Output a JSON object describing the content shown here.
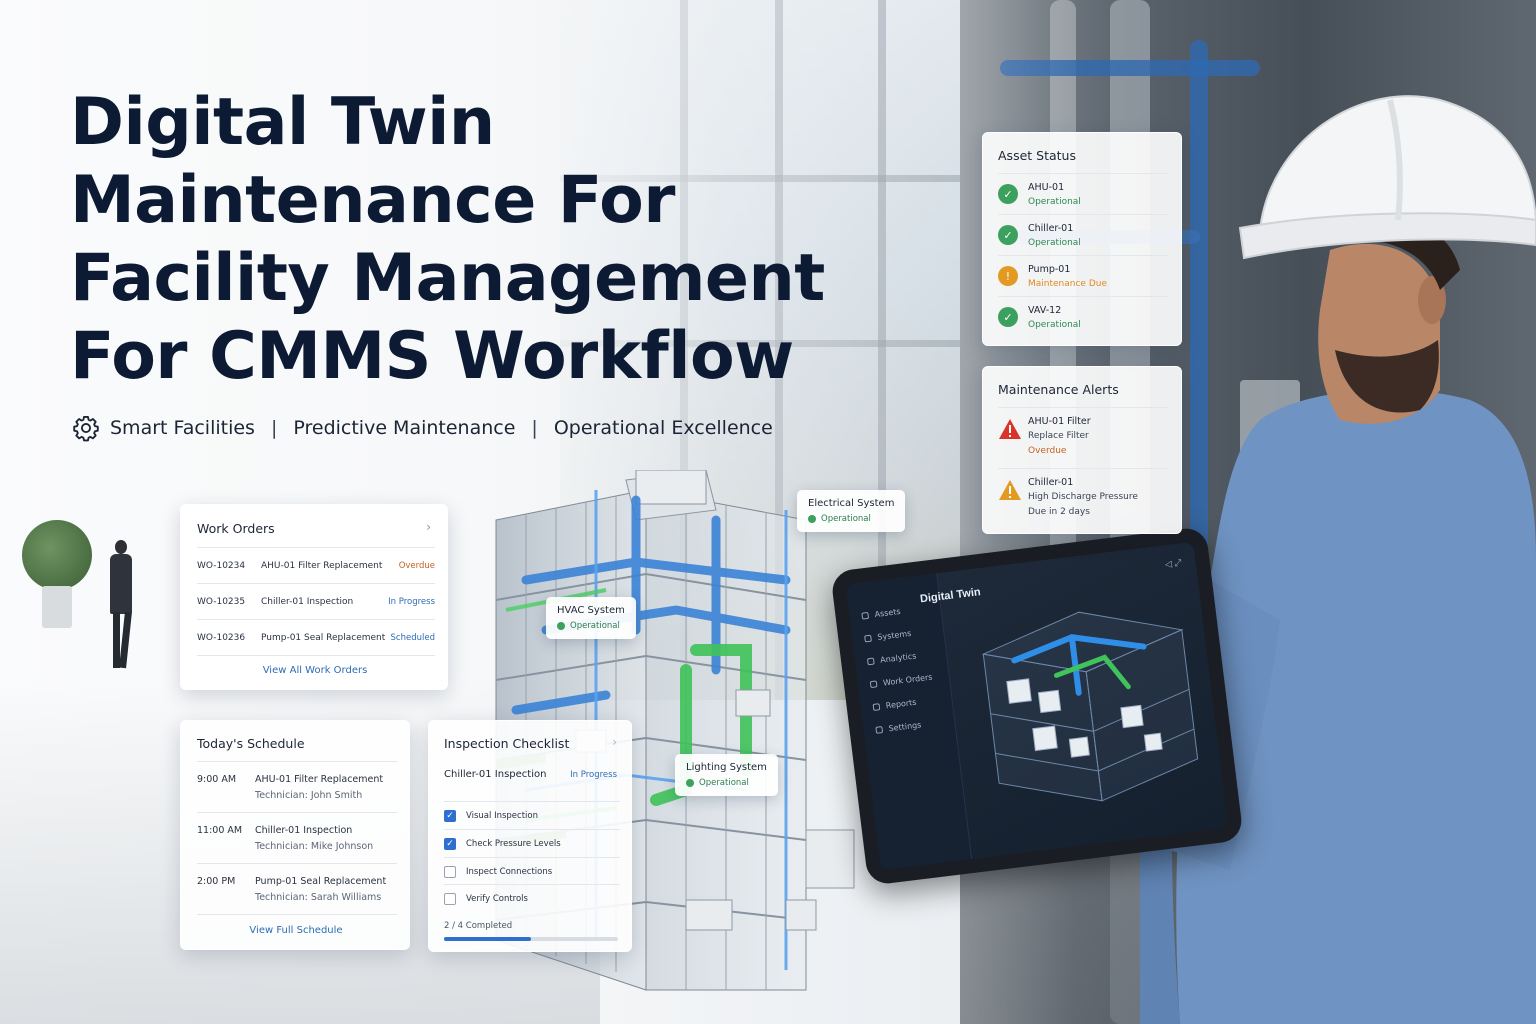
{
  "headline": {
    "line1": "Digital Twin",
    "line2": "Maintenance For",
    "line3": "Facility Management",
    "line4": "For CMMS Workflow"
  },
  "tagline": {
    "item1": "Smart Facilities",
    "sep": "|",
    "item2": "Predictive Maintenance",
    "item3": "Operational Excellence"
  },
  "work_orders": {
    "title": "Work Orders",
    "rows": [
      {
        "id": "WO-10234",
        "desc": "AHU-01 Filter Replacement",
        "status": "Overdue"
      },
      {
        "id": "WO-10235",
        "desc": "Chiller-01 Inspection",
        "status": "In Progress"
      },
      {
        "id": "WO-10236",
        "desc": "Pump-01 Seal Replacement",
        "status": "Scheduled"
      }
    ],
    "link": "View All Work Orders"
  },
  "schedule": {
    "title": "Today's Schedule",
    "rows": [
      {
        "time": "9:00 AM",
        "task": "AHU-01 Filter Replacement",
        "tech": "Technician: John Smith"
      },
      {
        "time": "11:00 AM",
        "task": "Chiller-01 Inspection",
        "tech": "Technician: Mike Johnson"
      },
      {
        "time": "2:00 PM",
        "task": "Pump-01 Seal Replacement",
        "tech": "Technician: Sarah Williams"
      }
    ],
    "link": "View Full Schedule"
  },
  "inspection": {
    "title": "Inspection Checklist",
    "subject": "Chiller-01 Inspection",
    "status": "In Progress",
    "items": [
      {
        "label": "Visual Inspection",
        "checked": true
      },
      {
        "label": "Check Pressure Levels",
        "checked": true
      },
      {
        "label": "Inspect Connections",
        "checked": false
      },
      {
        "label": "Verify Controls",
        "checked": false
      }
    ],
    "progress_label": "2 / 4 Completed",
    "progress": 0.5
  },
  "asset_status": {
    "title": "Asset Status",
    "rows": [
      {
        "name": "AHU-01",
        "status": "Operational"
      },
      {
        "name": "Chiller-01",
        "status": "Operational"
      },
      {
        "name": "Pump-01",
        "status": "Maintenance Due"
      },
      {
        "name": "VAV-12",
        "status": "Operational"
      }
    ]
  },
  "maintenance_alerts": {
    "title": "Maintenance Alerts",
    "rows": [
      {
        "l1": "AHU-01 Filter",
        "l2": "Replace Filter",
        "l3": "Overdue"
      },
      {
        "l1": "Chiller-01",
        "l2": "High Discharge Pressure",
        "l3": "Due in 2 days"
      }
    ]
  },
  "system_tags": {
    "electrical": {
      "name": "Electrical System",
      "status": "Operational"
    },
    "hvac": {
      "name": "HVAC System",
      "status": "Operational"
    },
    "lighting": {
      "name": "Lighting System",
      "status": "Operational"
    }
  },
  "tablet": {
    "title": "Digital Twin",
    "menu": [
      "Assets",
      "Systems",
      "Analytics",
      "Work Orders",
      "Reports",
      "Settings"
    ]
  },
  "colors": {
    "green": "#3ca05e",
    "orange": "#e39a22",
    "red": "#d8342c",
    "blue": "#2f6fd0",
    "navy": "#0c1a33"
  }
}
